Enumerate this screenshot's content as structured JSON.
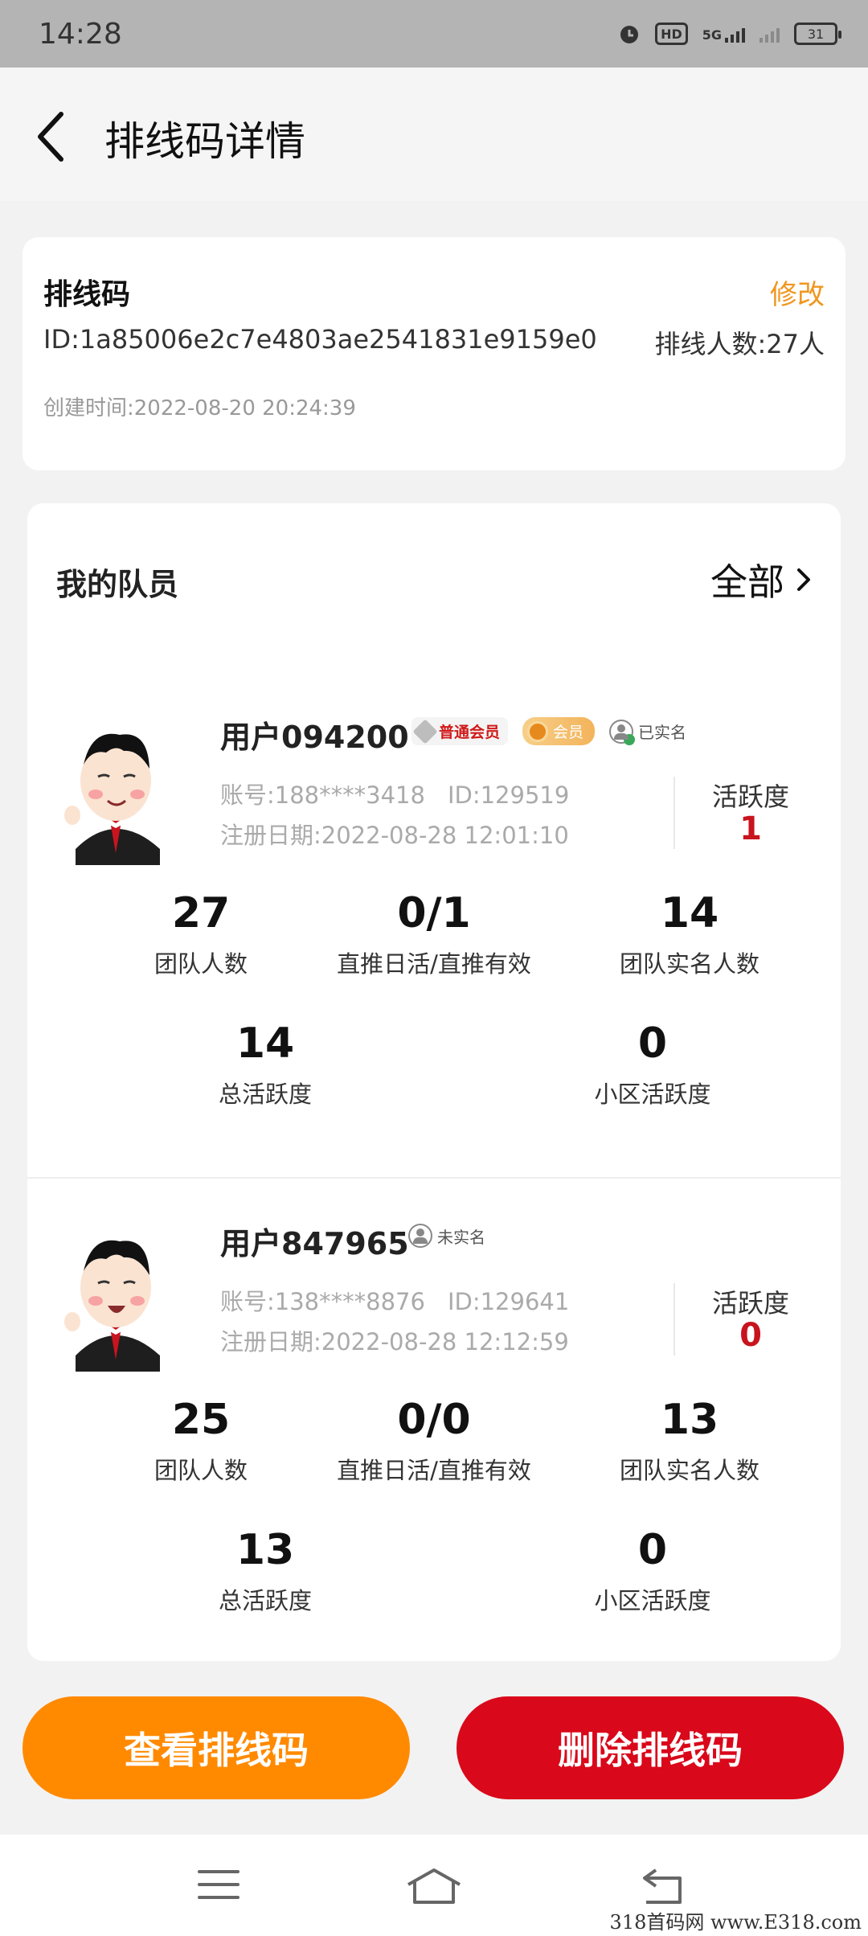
{
  "status_bar": {
    "time": "14:28",
    "hd_label": "HD",
    "network_label": "5G",
    "battery": "31"
  },
  "header": {
    "title": "排线码详情"
  },
  "code_card": {
    "title": "排线码",
    "edit_label": "修改",
    "id_text": "ID:1a85006e2c7e4803ae2541831e9159e0",
    "queue_count_text": "排线人数:27人",
    "created_text": "创建时间:2022-08-20 20:24:39"
  },
  "team": {
    "title": "我的队员",
    "all_label": "全部",
    "activity_label": "活跃度",
    "members": [
      {
        "name": "用户094200",
        "badges": {
          "normal": "普通会员",
          "vip": "会员",
          "real": "已实名"
        },
        "account": "账号:188****3418",
        "user_id": "ID:129519",
        "register": "注册日期:2022-08-28 12:01:10",
        "activity": "1",
        "stats": [
          {
            "value": "27",
            "label": "团队人数"
          },
          {
            "value": "0/1",
            "label": "直推日活/直推有效"
          },
          {
            "value": "14",
            "label": "团队实名人数"
          },
          {
            "value": "14",
            "label": "总活跃度"
          },
          {
            "value": "0",
            "label": "小区活跃度"
          }
        ]
      },
      {
        "name": "用户847965",
        "badges": {
          "real": "未实名"
        },
        "account": "账号:138****8876",
        "user_id": "ID:129641",
        "register": "注册日期:2022-08-28 12:12:59",
        "activity": "0",
        "stats": [
          {
            "value": "25",
            "label": "团队人数"
          },
          {
            "value": "0/0",
            "label": "直推日活/直推有效"
          },
          {
            "value": "13",
            "label": "团队实名人数"
          },
          {
            "value": "13",
            "label": "总活跃度"
          },
          {
            "value": "0",
            "label": "小区活跃度"
          }
        ]
      }
    ]
  },
  "actions": {
    "view_label": "查看排线码",
    "delete_label": "删除排线码"
  },
  "watermark": "318首码网 www.E318.com",
  "colors": {
    "accent_orange": "#ff8a00",
    "danger_red": "#d9081a",
    "edit_orange": "#f0961e",
    "activity_red": "#c8141e"
  }
}
